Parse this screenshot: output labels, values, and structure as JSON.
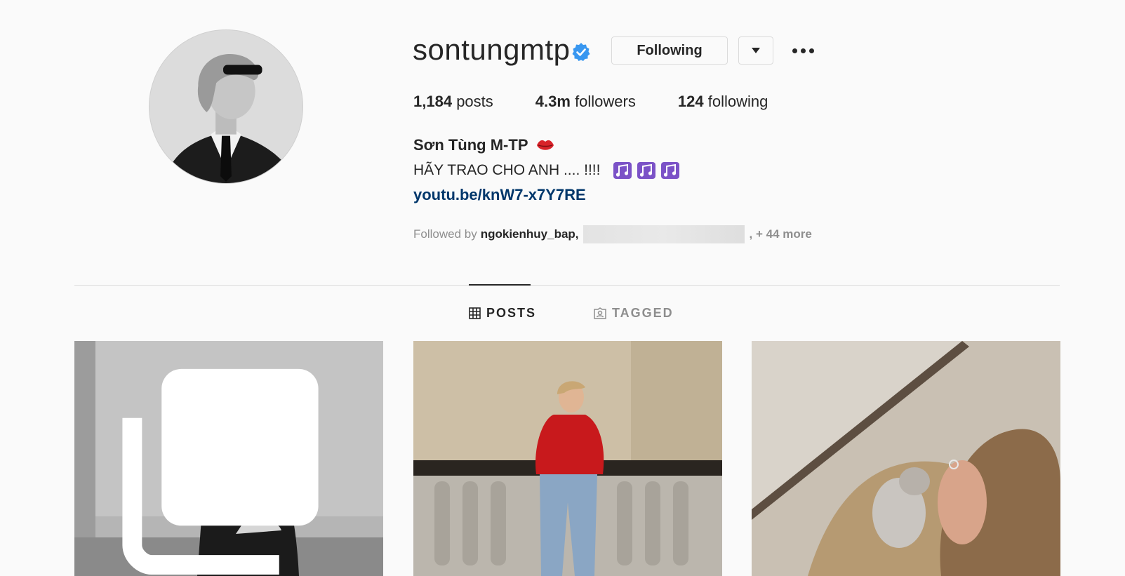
{
  "profile": {
    "username": "sontungmtp",
    "following_label": "Following",
    "posts_count": "1,184",
    "posts_label": "posts",
    "followers_count": "4.3m",
    "followers_label": "followers",
    "following_count": "124",
    "following_stat_label": "following",
    "full_name": "Sơn Tùng M-TP",
    "bio": "HÃY TRAO CHO ANH .... !!!!",
    "link": "youtu.be/knW7-x7Y7RE",
    "followed_by_label": "Followed by",
    "followed_by_name": "ngokienhuy_bap,",
    "followed_by_more": ", + 44 more"
  },
  "tabs": [
    {
      "label": "POSTS",
      "active": true
    },
    {
      "label": "TAGGED",
      "active": false
    }
  ],
  "colors": {
    "verified": "#3897f0",
    "link": "#00376b",
    "music_emoji": "#7b52c7"
  },
  "icons": [
    "verified-badge-icon",
    "chevron-down-icon",
    "more-options-icon",
    "lips-emoji-icon",
    "music-notes-emoji-icon",
    "grid-icon",
    "tagged-icon",
    "multiple-images-icon"
  ]
}
